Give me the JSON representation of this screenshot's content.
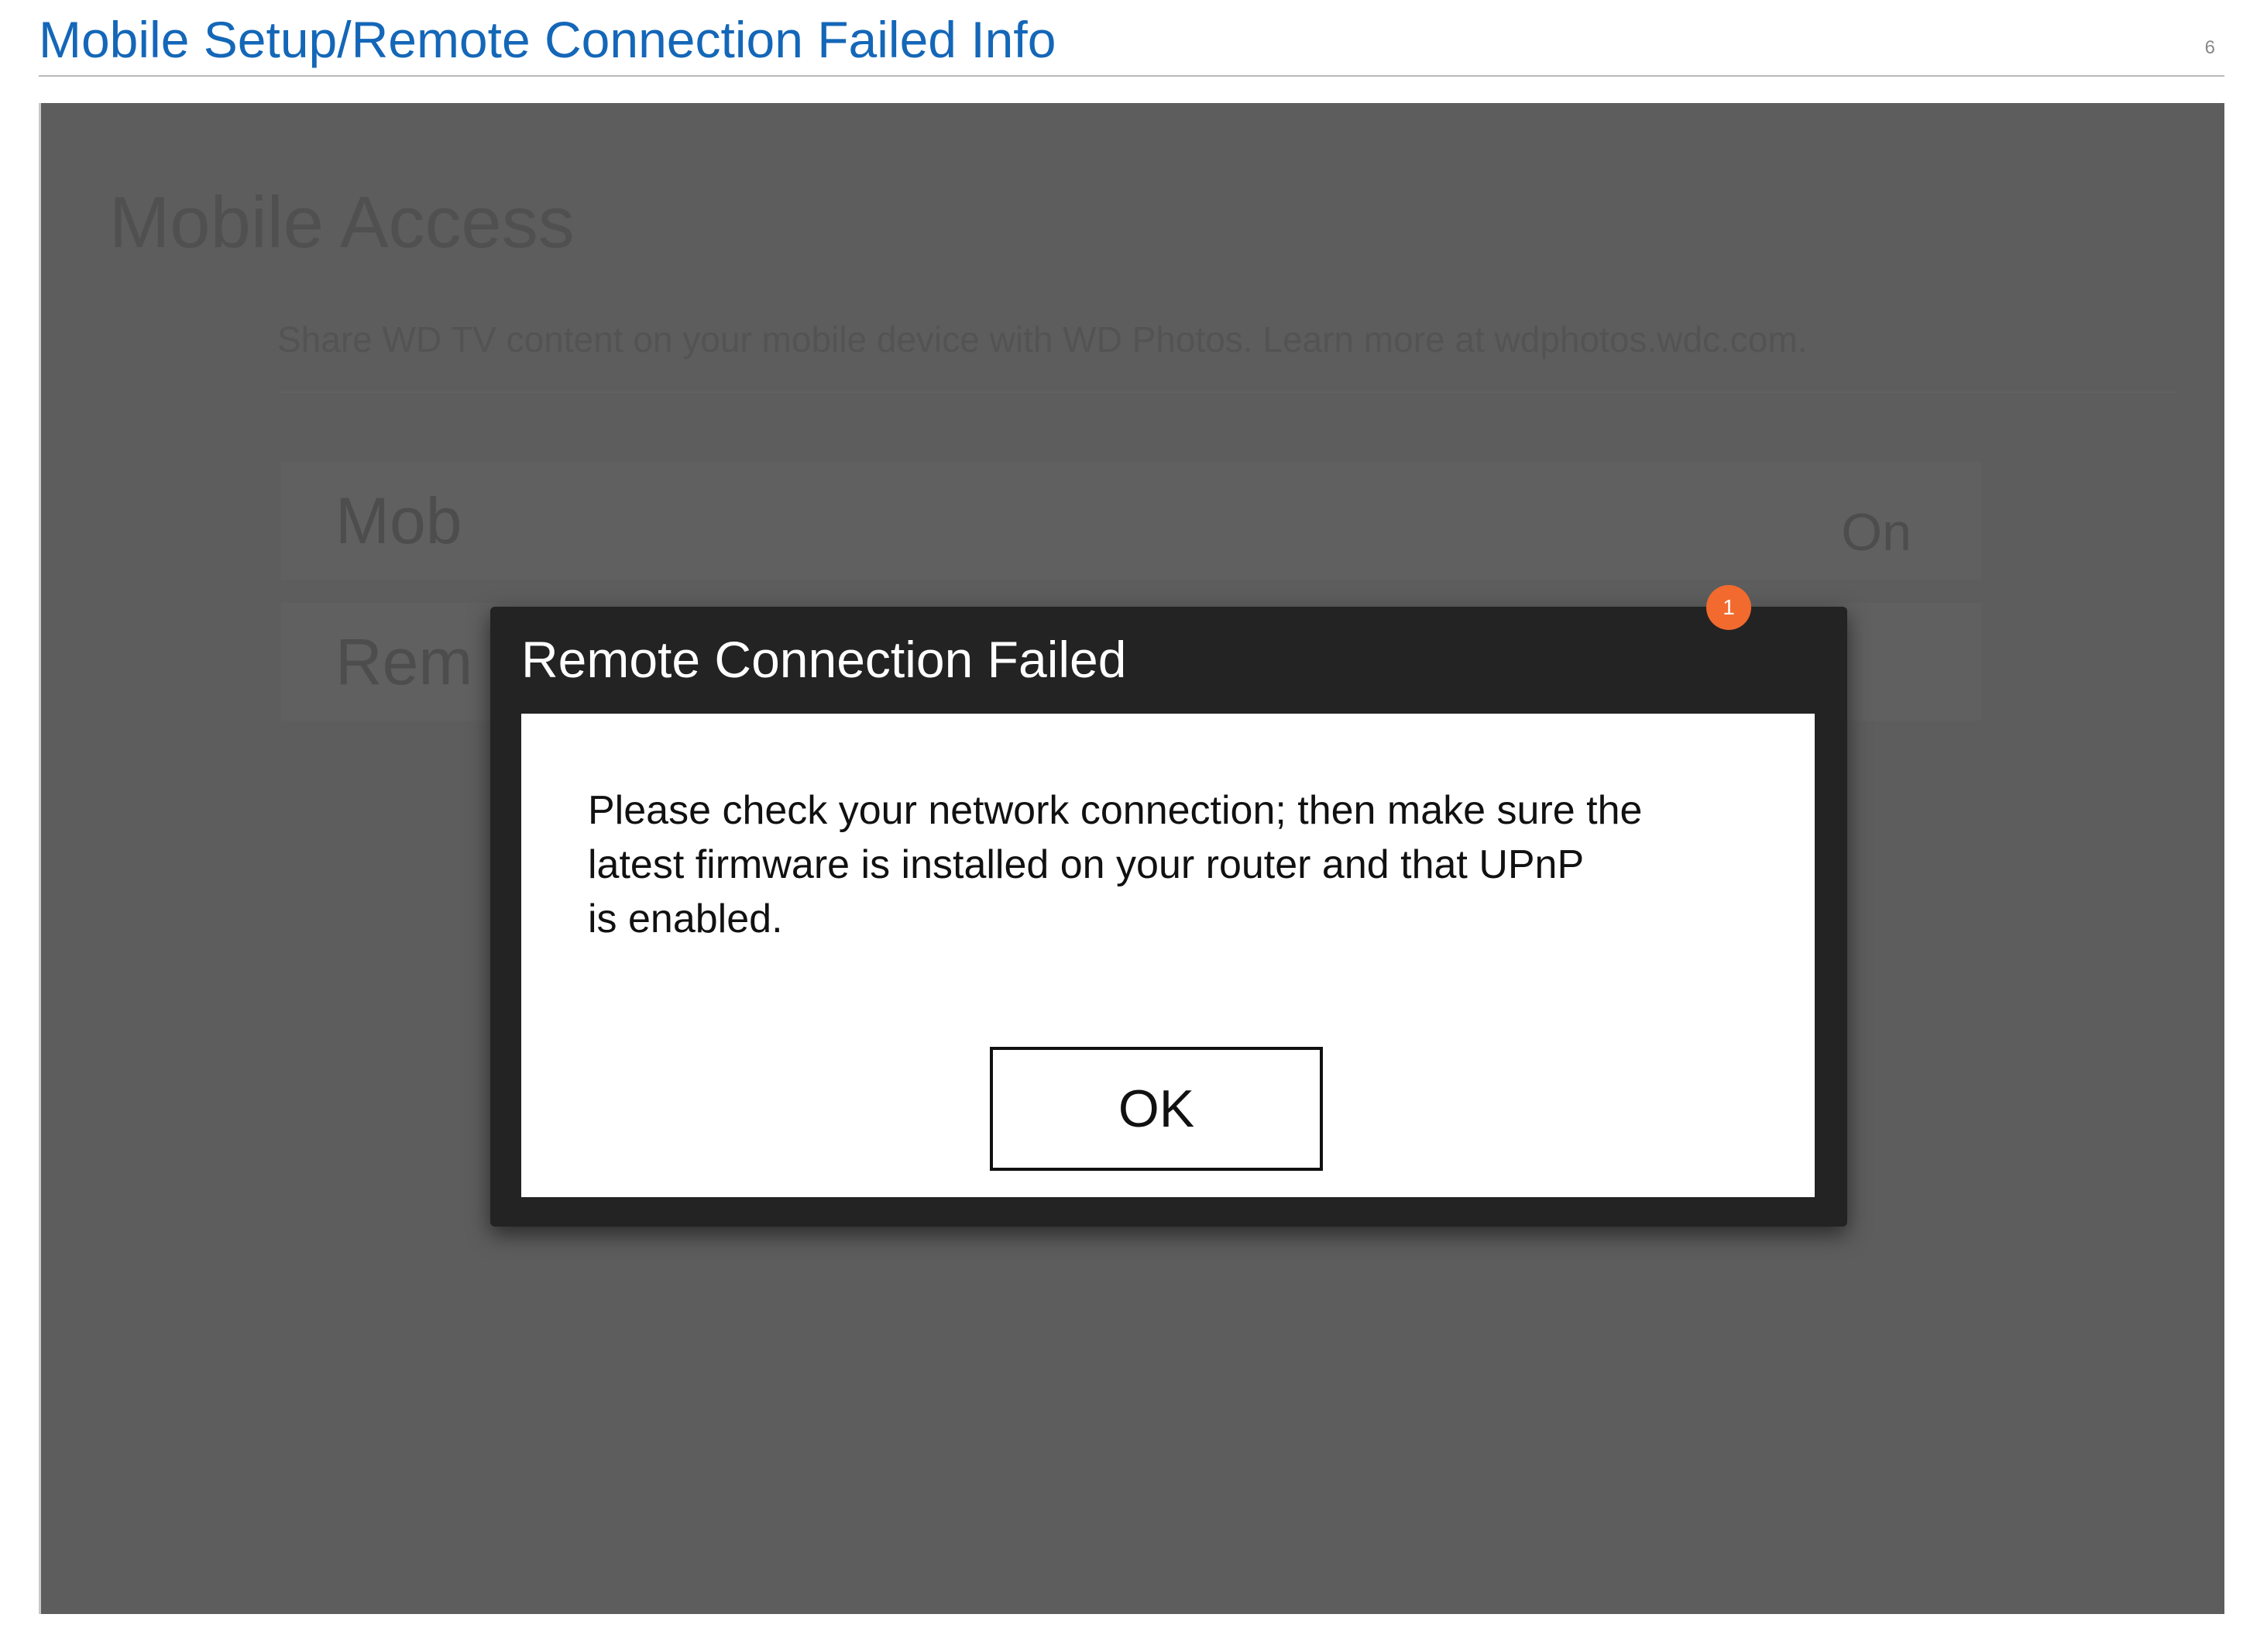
{
  "document": {
    "title": "Mobile Setup/Remote Connection Failed Info",
    "page_number": "6",
    "accent_color": "#1467b8"
  },
  "screen": {
    "heading": "Mobile Access",
    "subtitle": "Share WD TV content on your mobile device with WD Photos. Learn more at wdphotos.wdc.com.",
    "rows": [
      {
        "label": "Mob",
        "value": "On"
      },
      {
        "label": "Rem",
        "value": ""
      }
    ]
  },
  "dialog": {
    "title": "Remote Connection Failed",
    "message_lines": [
      "Please check your network connection; then make sure the",
      "latest firmware is installed on your router and that UPnP",
      "is enabled."
    ],
    "ok_label": "OK",
    "callout": "1",
    "callout_color": "#f26a2e"
  }
}
